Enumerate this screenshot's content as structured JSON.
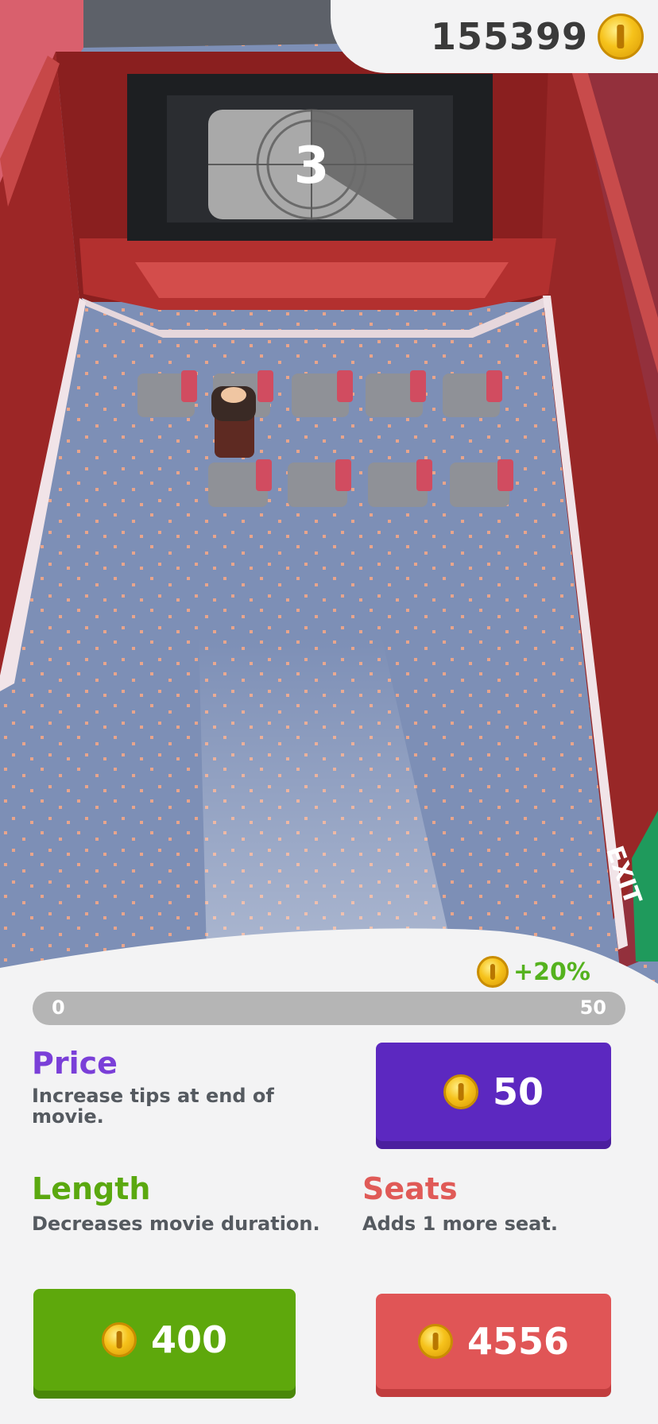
{
  "hud": {
    "coins": "155399",
    "coin_icon": "coin-icon"
  },
  "screen": {
    "countdown": "3"
  },
  "exit_sign": {
    "text": "EXIT"
  },
  "upgrades_panel": {
    "bonus": "+20%",
    "progress": {
      "min_label": "0",
      "max_label": "50",
      "fraction": 0
    },
    "price": {
      "title": "Price",
      "description": "Increase tips at end of movie.",
      "cost": "50",
      "color": "#7a3fd8",
      "button_color": "#5c28c0"
    },
    "length": {
      "title": "Length",
      "description": "Decreases movie duration.",
      "cost": "400",
      "color": "#5aa80f",
      "button_color": "#5ea80c"
    },
    "seats": {
      "title": "Seats",
      "description": "Adds 1 more seat.",
      "cost": "4556",
      "color": "#e05a57",
      "button_color": "#e05556"
    }
  }
}
